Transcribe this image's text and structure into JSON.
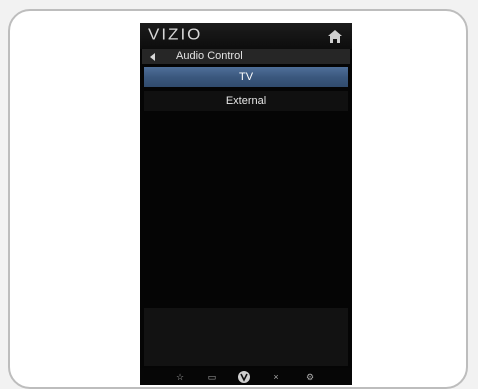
{
  "logo": "VIZIO",
  "breadcrumb": {
    "label": "Audio Control"
  },
  "menu": {
    "items": [
      {
        "label": "TV",
        "selected": true
      },
      {
        "label": "External",
        "selected": false
      }
    ]
  },
  "bottom_bar": {
    "icons": [
      "star-icon",
      "widget-icon",
      "vizio-v-icon",
      "close-x-icon",
      "gear-icon"
    ],
    "glyphs": [
      "☆",
      "▭",
      "V",
      "×",
      "⚙"
    ]
  },
  "colors": {
    "selection": "#3b587e",
    "panel": "#050505"
  }
}
